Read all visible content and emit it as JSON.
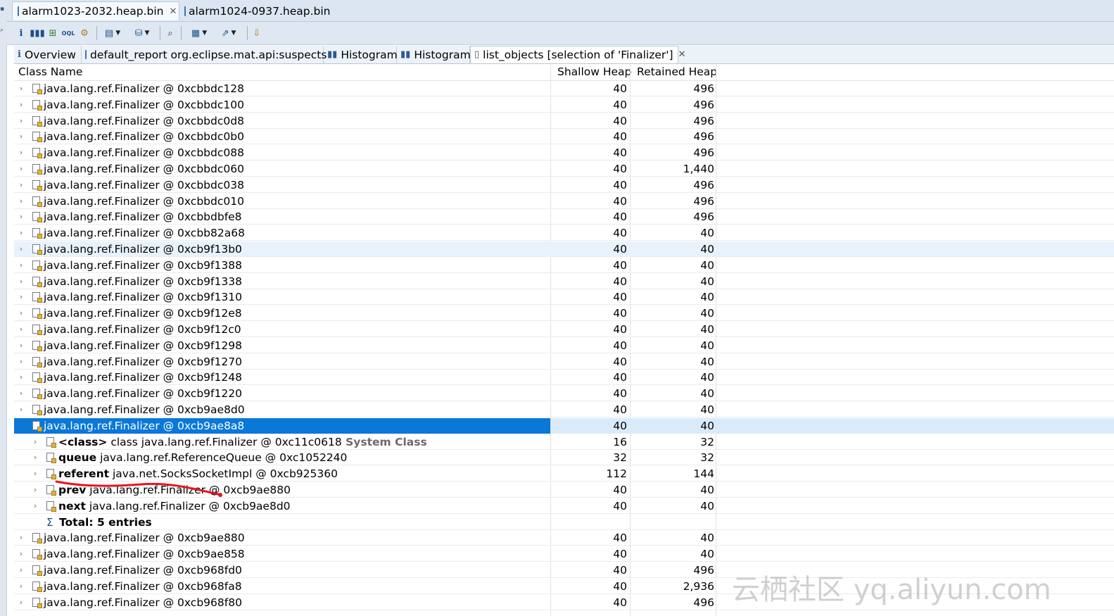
{
  "editor_tabs": [
    {
      "label": "alarm1023-2032.heap.bin",
      "icon": "database-icon",
      "closable": true
    },
    {
      "label": "alarm1024-0937.heap.bin",
      "icon": "database-icon",
      "closable": false
    }
  ],
  "toolbar": {
    "items": [
      "info-icon",
      "histogram-icon",
      "dominator-tree-icon",
      "oql-icon",
      "thread-overview-icon",
      "run-expert-report-icon",
      "query-browser-icon",
      "search-icon",
      "group-by-icon",
      "calculate-retained-icon",
      "export-icon"
    ]
  },
  "view_tabs": [
    {
      "label": "Overview",
      "icon": "info-icon"
    },
    {
      "label": "default_report  org.eclipse.mat.api:suspects",
      "icon": "report-icon"
    },
    {
      "label": "Histogram",
      "icon": "histogram-icon"
    },
    {
      "label": "Histogram",
      "icon": "histogram-icon"
    },
    {
      "label": "list_objects [selection of 'Finalizer']",
      "icon": "object-list-icon",
      "active": true,
      "closable": true
    }
  ],
  "table": {
    "columns": [
      "Class Name",
      "Shallow Heap",
      "Retained Heap"
    ],
    "rows_before": [
      {
        "name": "java.lang.ref.Finalizer @ 0xcbbdc128",
        "shallow": "40",
        "retained": "496"
      },
      {
        "name": "java.lang.ref.Finalizer @ 0xcbbdc100",
        "shallow": "40",
        "retained": "496"
      },
      {
        "name": "java.lang.ref.Finalizer @ 0xcbbdc0d8",
        "shallow": "40",
        "retained": "496"
      },
      {
        "name": "java.lang.ref.Finalizer @ 0xcbbdc0b0",
        "shallow": "40",
        "retained": "496"
      },
      {
        "name": "java.lang.ref.Finalizer @ 0xcbbdc088",
        "shallow": "40",
        "retained": "496"
      },
      {
        "name": "java.lang.ref.Finalizer @ 0xcbbdc060",
        "shallow": "40",
        "retained": "1,440"
      },
      {
        "name": "java.lang.ref.Finalizer @ 0xcbbdc038",
        "shallow": "40",
        "retained": "496"
      },
      {
        "name": "java.lang.ref.Finalizer @ 0xcbbdc010",
        "shallow": "40",
        "retained": "496"
      },
      {
        "name": "java.lang.ref.Finalizer @ 0xcbbdbfe8",
        "shallow": "40",
        "retained": "496"
      },
      {
        "name": "java.lang.ref.Finalizer @ 0xcbb82a68",
        "shallow": "40",
        "retained": "40"
      },
      {
        "name": "java.lang.ref.Finalizer @ 0xcb9f13b0",
        "shallow": "40",
        "retained": "40"
      },
      {
        "name": "java.lang.ref.Finalizer @ 0xcb9f1388",
        "shallow": "40",
        "retained": "40"
      },
      {
        "name": "java.lang.ref.Finalizer @ 0xcb9f1338",
        "shallow": "40",
        "retained": "40"
      },
      {
        "name": "java.lang.ref.Finalizer @ 0xcb9f1310",
        "shallow": "40",
        "retained": "40"
      },
      {
        "name": "java.lang.ref.Finalizer @ 0xcb9f12e8",
        "shallow": "40",
        "retained": "40"
      },
      {
        "name": "java.lang.ref.Finalizer @ 0xcb9f12c0",
        "shallow": "40",
        "retained": "40"
      },
      {
        "name": "java.lang.ref.Finalizer @ 0xcb9f1298",
        "shallow": "40",
        "retained": "40"
      },
      {
        "name": "java.lang.ref.Finalizer @ 0xcb9f1270",
        "shallow": "40",
        "retained": "40"
      },
      {
        "name": "java.lang.ref.Finalizer @ 0xcb9f1248",
        "shallow": "40",
        "retained": "40"
      },
      {
        "name": "java.lang.ref.Finalizer @ 0xcb9f1220",
        "shallow": "40",
        "retained": "40"
      },
      {
        "name": "java.lang.ref.Finalizer @ 0xcb9ae8d0",
        "shallow": "40",
        "retained": "40"
      }
    ],
    "selected_row": {
      "name": "java.lang.ref.Finalizer @ 0xcb9ae8a8",
      "shallow": "40",
      "retained": "40"
    },
    "children": [
      {
        "field": "<class>",
        "value": "class java.lang.ref.Finalizer @ 0xc11c0618",
        "suffix": "System Class",
        "shallow": "16",
        "retained": "32"
      },
      {
        "field": "queue",
        "value": "java.lang.ref.ReferenceQueue @ 0xc1052240",
        "suffix": "",
        "shallow": "32",
        "retained": "32"
      },
      {
        "field": "referent",
        "value": "java.net.SocksSocketImpl @ 0xcb925360",
        "suffix": "",
        "shallow": "112",
        "retained": "144"
      },
      {
        "field": "prev",
        "value": "java.lang.ref.Finalizer @ 0xcb9ae880",
        "suffix": "",
        "shallow": "40",
        "retained": "40"
      },
      {
        "field": "next",
        "value": "java.lang.ref.Finalizer @ 0xcb9ae8d0",
        "suffix": "",
        "shallow": "40",
        "retained": "40"
      }
    ],
    "total_label": "Total: 5 entries",
    "rows_after": [
      {
        "name": "java.lang.ref.Finalizer @ 0xcb9ae880",
        "shallow": "40",
        "retained": "40"
      },
      {
        "name": "java.lang.ref.Finalizer @ 0xcb9ae858",
        "shallow": "40",
        "retained": "40"
      },
      {
        "name": "java.lang.ref.Finalizer @ 0xcb968fd0",
        "shallow": "40",
        "retained": "496"
      },
      {
        "name": "java.lang.ref.Finalizer @ 0xcb968fa8",
        "shallow": "40",
        "retained": "2,936"
      },
      {
        "name": "java.lang.ref.Finalizer @ 0xcb968f80",
        "shallow": "40",
        "retained": "496"
      }
    ]
  },
  "colors": {
    "selection": "#0a78d7",
    "hover": "#e8f2fd",
    "annotation": "#e8141e"
  },
  "watermark": "云栖社区 yq.aliyun.com"
}
